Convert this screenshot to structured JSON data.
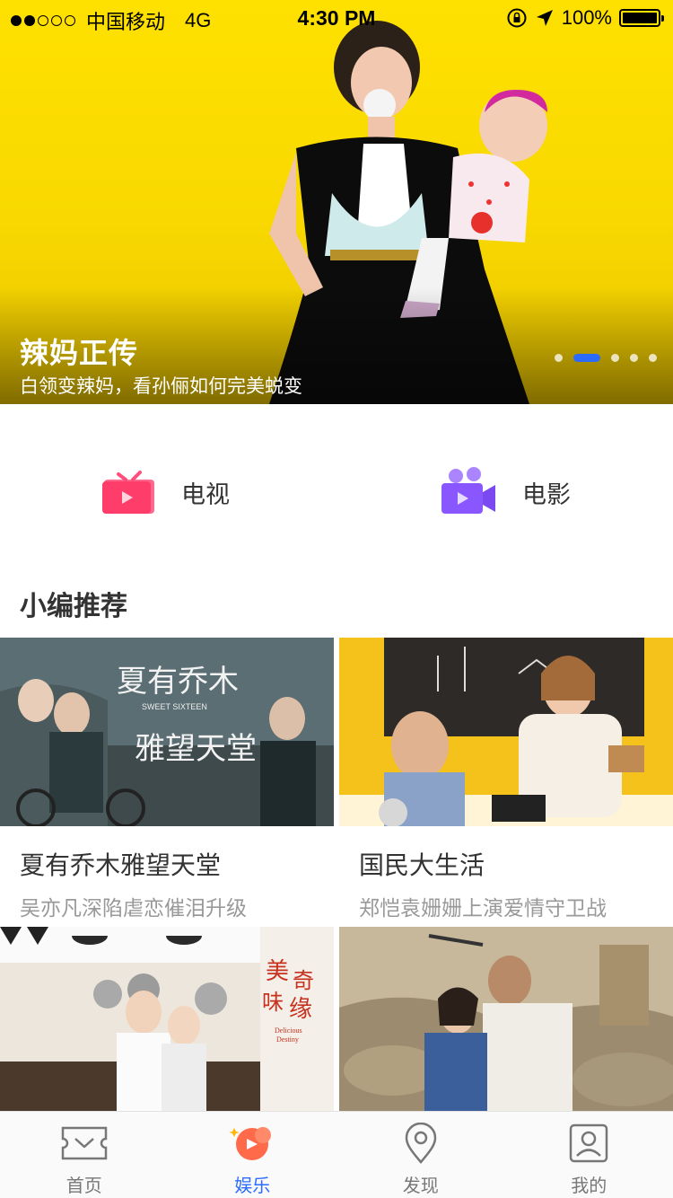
{
  "status_bar": {
    "carrier": "中国移动",
    "network": "4G",
    "time": "4:30 PM",
    "battery": "100%"
  },
  "hero": {
    "title": "辣妈正传",
    "subtitle": "白领变辣妈，看孙俪如何完美蜕变",
    "slide_count": 5,
    "active_slide": 2
  },
  "categories": [
    {
      "label": "电视",
      "icon": "tv-icon",
      "color": "#ff4f7a"
    },
    {
      "label": "电影",
      "icon": "movie-camera-icon",
      "color": "#8f5cff"
    }
  ],
  "section": {
    "title": "小编推荐"
  },
  "cards": [
    {
      "title": "夏有乔木雅望天堂",
      "desc": "吴亦凡深陷虐恋催泪升级",
      "poster_text": "夏有乔木 雅望天堂",
      "poster_sub": "SWEET SIXTEEN"
    },
    {
      "title": "国民大生活",
      "desc": "郑恺袁姗姗上演爱情守卫战"
    },
    {
      "poster_text": "美味奇缘",
      "poster_sub": "Delicious Destiny"
    },
    {}
  ],
  "tabbar": [
    {
      "label": "首页",
      "icon": "ticket-icon",
      "active": false
    },
    {
      "label": "娱乐",
      "icon": "entertainment-icon",
      "active": true
    },
    {
      "label": "发现",
      "icon": "location-pin-icon",
      "active": false
    },
    {
      "label": "我的",
      "icon": "profile-icon",
      "active": false
    }
  ],
  "colors": {
    "accent": "#2c6bff",
    "hero_bg": "#ffe100",
    "tv": "#ff4f7a",
    "movie": "#8f5cff",
    "entertainment": "#ff6b4a"
  }
}
